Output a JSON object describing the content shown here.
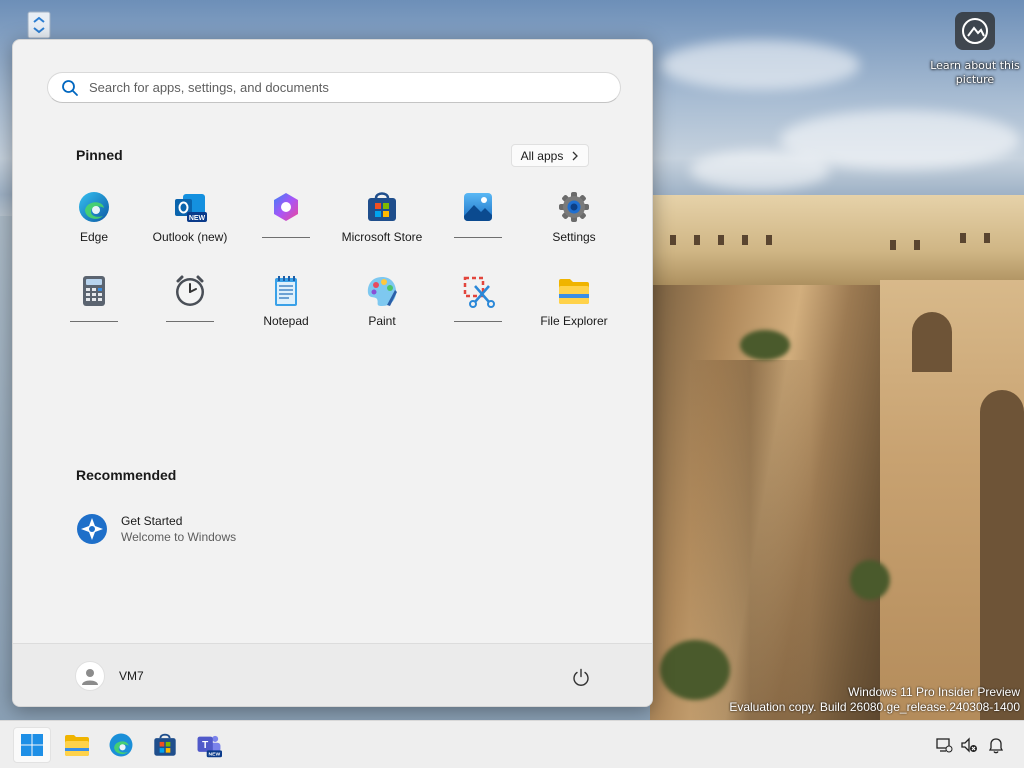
{
  "desktop": {
    "learn_label": "Learn about this picture",
    "watermark_line1": "Windows 11 Pro Insider Preview",
    "watermark_line2": "Evaluation copy. Build 26080.ge_release.240308-1400"
  },
  "start_menu": {
    "search_placeholder": "Search for apps, settings, and documents",
    "pinned_title": "Pinned",
    "all_apps_label": "All apps",
    "pinned_apps": [
      {
        "label": "Edge",
        "icon": "edge-icon"
      },
      {
        "label": "Outlook (new)",
        "icon": "outlook-icon"
      },
      {
        "label": "",
        "icon": "copilot-icon"
      },
      {
        "label": "Microsoft Store",
        "icon": "store-icon"
      },
      {
        "label": "",
        "icon": "photos-icon"
      },
      {
        "label": "Settings",
        "icon": "settings-icon"
      },
      {
        "label": "",
        "icon": "calculator-icon"
      },
      {
        "label": "",
        "icon": "clock-icon"
      },
      {
        "label": "Notepad",
        "icon": "notepad-icon"
      },
      {
        "label": "Paint",
        "icon": "paint-icon"
      },
      {
        "label": "",
        "icon": "snipping-tool-icon"
      },
      {
        "label": "File Explorer",
        "icon": "file-explorer-icon"
      }
    ],
    "recommended_title": "Recommended",
    "recommended": [
      {
        "title": "Get Started",
        "subtitle": "Welcome to Windows",
        "icon": "get-started-icon"
      }
    ],
    "user_name": "VM7"
  },
  "taskbar": {
    "apps": [
      "start-icon",
      "file-explorer-icon",
      "edge-icon",
      "store-icon",
      "teams-icon"
    ],
    "tray": [
      "network-icon",
      "volume-muted-icon",
      "notification-icon"
    ]
  },
  "colors": {
    "menu_bg": "#f2f2f2",
    "accent": "#0067c0",
    "taskbar_bg": "#eeeeee"
  }
}
